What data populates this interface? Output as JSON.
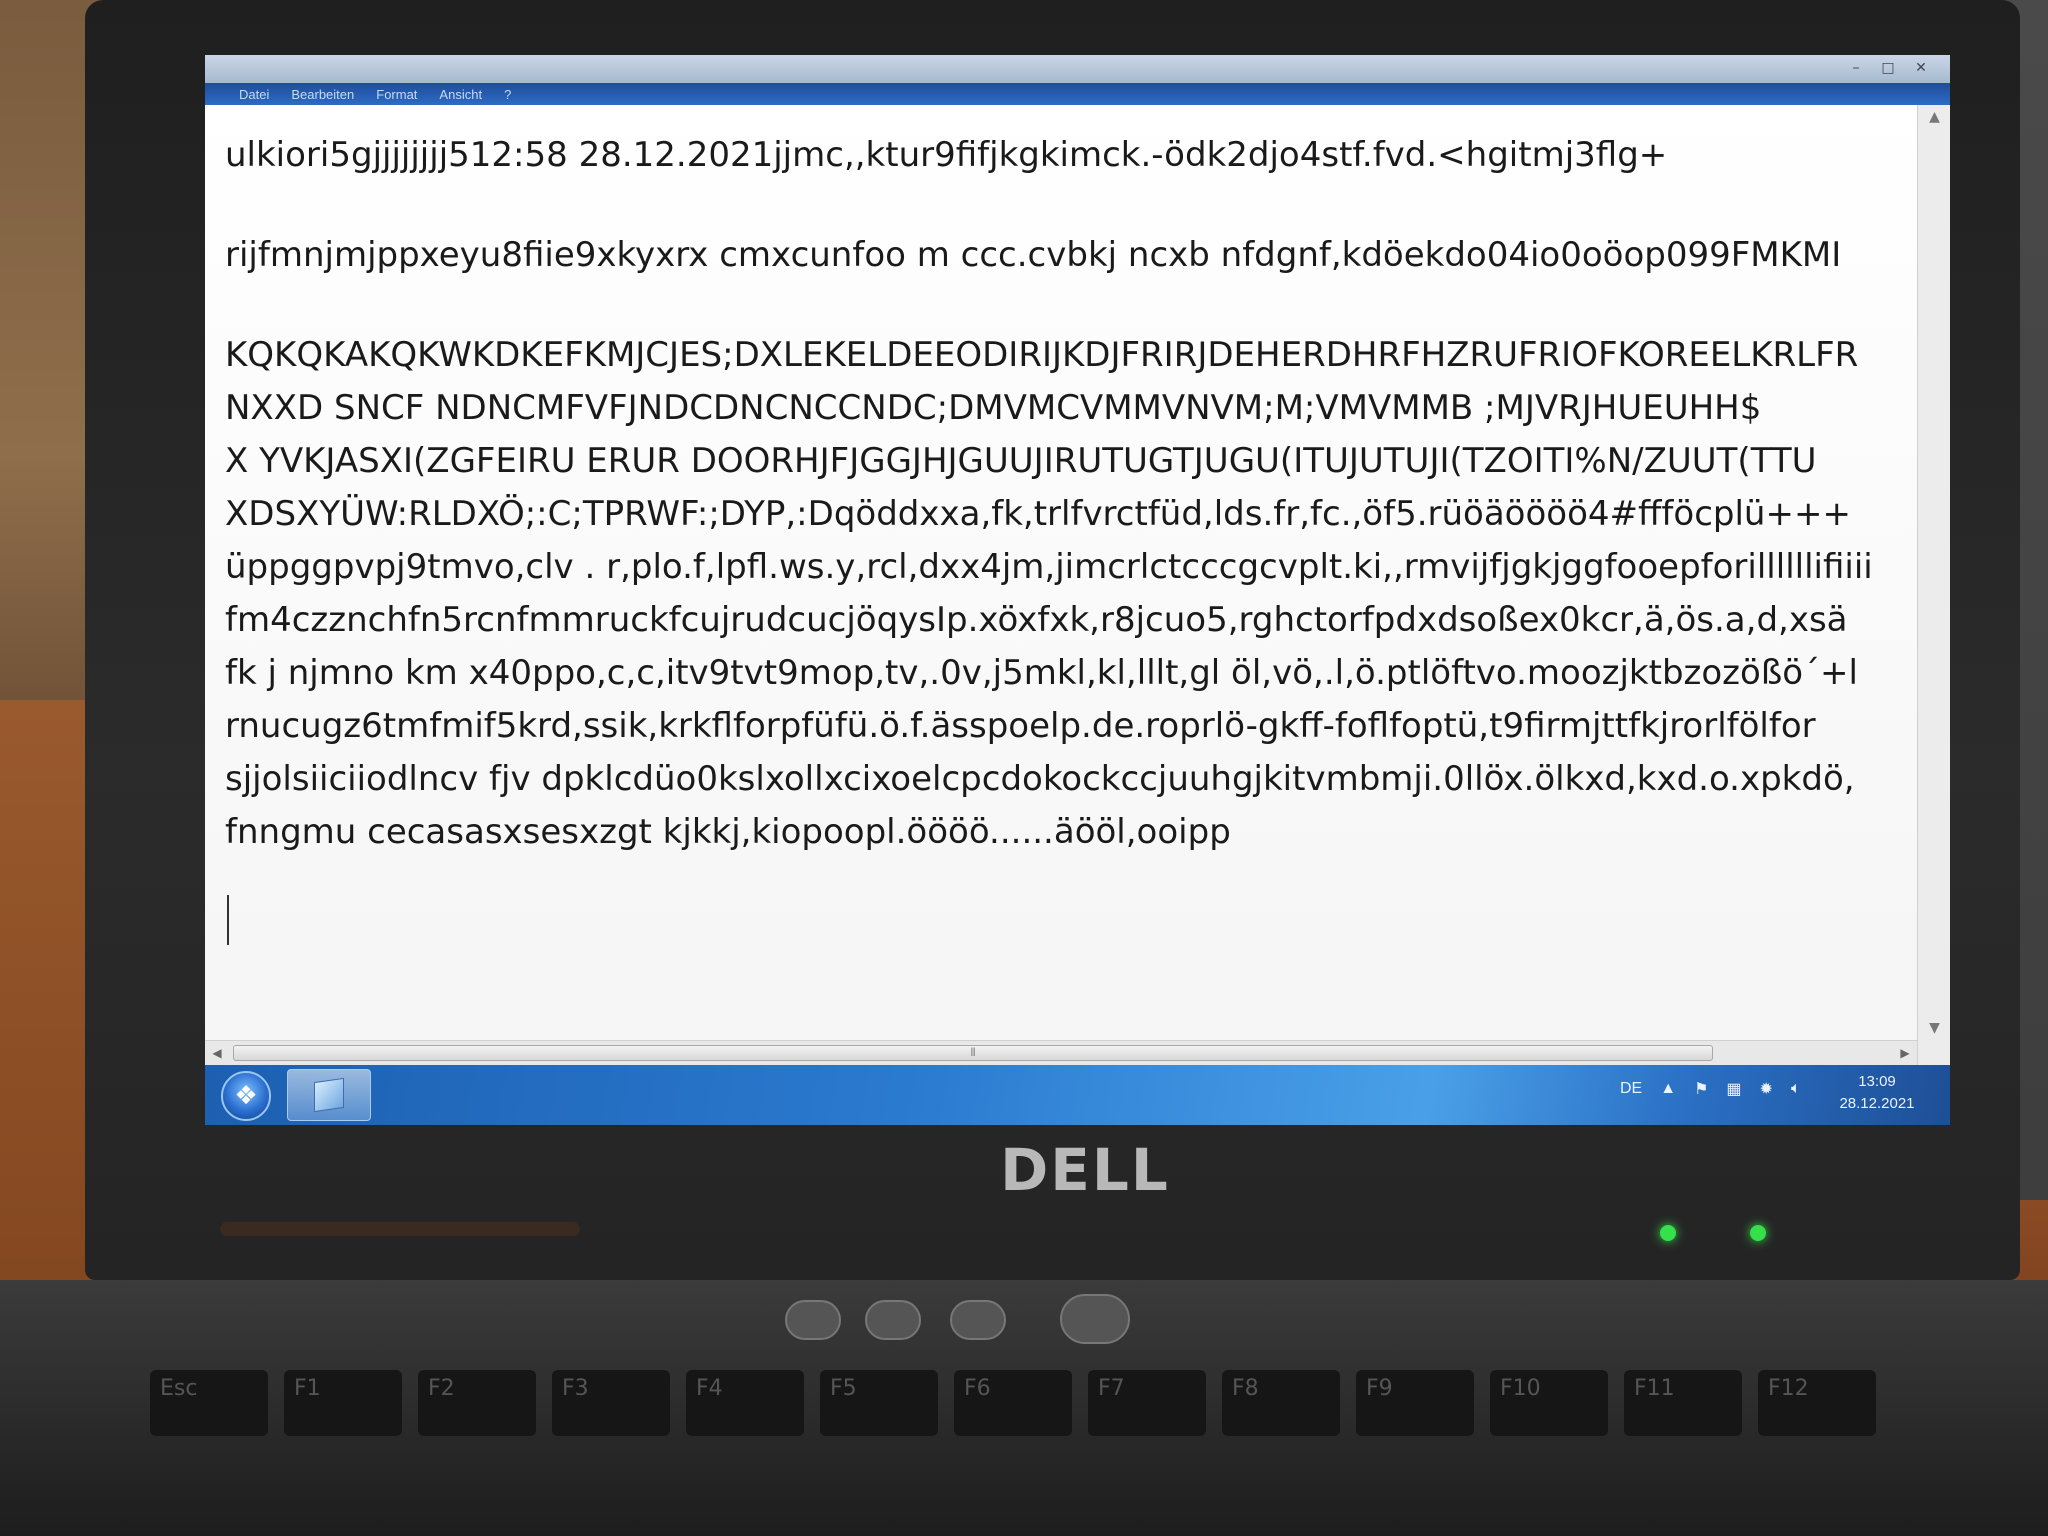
{
  "device": {
    "brand": "DELL"
  },
  "window": {
    "menu": [
      "Datei",
      "Bearbeiten",
      "Format",
      "Ansicht",
      "?"
    ],
    "controls": [
      "–",
      "□",
      "✕"
    ]
  },
  "editor": {
    "lines": [
      "ulkiori5gjjjjjjjj512:58 28.12.2021jjmc,,ktur9fifjkgkimck.-ödk2djo4stf.fvd.<hgitmj3flg+",
      "rijfmnjmjppxeyu8fiie9xkyxrx  cmxcunfoo m ccc.cvbkj ncxb nfdgnf,kdöekdo04io0oöop099FMKMI",
      "KQKQKAKQKWKDKEFKMJCJES;DXLEKELDEEODIRIJKDJFRIRJDEHERDHRFHZRUFRIOFKOREELKRLFR",
      " NXXD SNCF NDNCMFVFJNDCDNCNCCNDC;DMVMCVMMVNVM;M;VMVMMB ;MJVRJHUEUHH$",
      "X YVKJASXI(ZGFEIRU ERUR DOORHJFJGGJHJGUUJIRUTUGTJUGU(ITUJUTUJI(TZOITI%N/ZUUT(TTU",
      "XDSXYÜW:RLDXÖ;:C;TPRWF:;DYP,:Dqöddxxa,fk,trlfvrctfüd,lds.fr,fc.,öf5.rüöäöööö4#ffföcplü+++",
      "üppggpvpj9tmvo,clv . r,plo.f,lpfl.ws.y,rcl,dxx4jm,jimcrlctcccgcvplt.ki,,rmvijfjgkjggfooepforillllllifiiii",
      "fm4czznchfn5rcnfmmruckfcujrudcucjöqysIp.xöxfxk,r8jcuo5,rghctorfpdxdsoßex0kcr,ä,ös.a,d,xsä",
      "fk j njmno km  x40ppo,c,c,itv9tvt9mop,tv,.0v,j5mkl,kl,lllt,gl öl,vö,.l,ö.ptlöftvo.moozjktbzozößö´+l",
      "rnucugz6tmfmif5krd,ssik,krkflforpfüfü.ö.f.ässpoelp.de.roprlö-gkff-foflfoptü,t9firmjttfkjrorlfölfor",
      "sjjolsiiciiodlncv fjv dpklcdüo0kslxollxcixoelcpcdokockccjuuhgjkitvmbmji.0llöx.ölkxd,kxd.o.xpkdö,",
      "fnngmu cecasasxsesxzgt kjkkj,kiopoopl.öööö......äööl,ooipp"
    ]
  },
  "taskbar": {
    "start_icon": "windows-orb-icon",
    "language": "DE",
    "tray_icons": [
      "show-hidden-icon",
      "action-center-flag-icon",
      "network-icon",
      "power-icon",
      "volume-icon"
    ],
    "time": "13:09",
    "date": "28.12.2021"
  },
  "colors": {
    "taskbar": "#2a7ad0",
    "editor_bg": "#ffffff",
    "bezel": "#242424",
    "led": "#35e04a"
  },
  "keyboard": {
    "row_fn": [
      "Esc",
      "F1",
      "F2",
      "F3",
      "F4",
      "F5",
      "F6",
      "F7",
      "F8",
      "F9",
      "F10",
      "F11",
      "F12"
    ]
  }
}
